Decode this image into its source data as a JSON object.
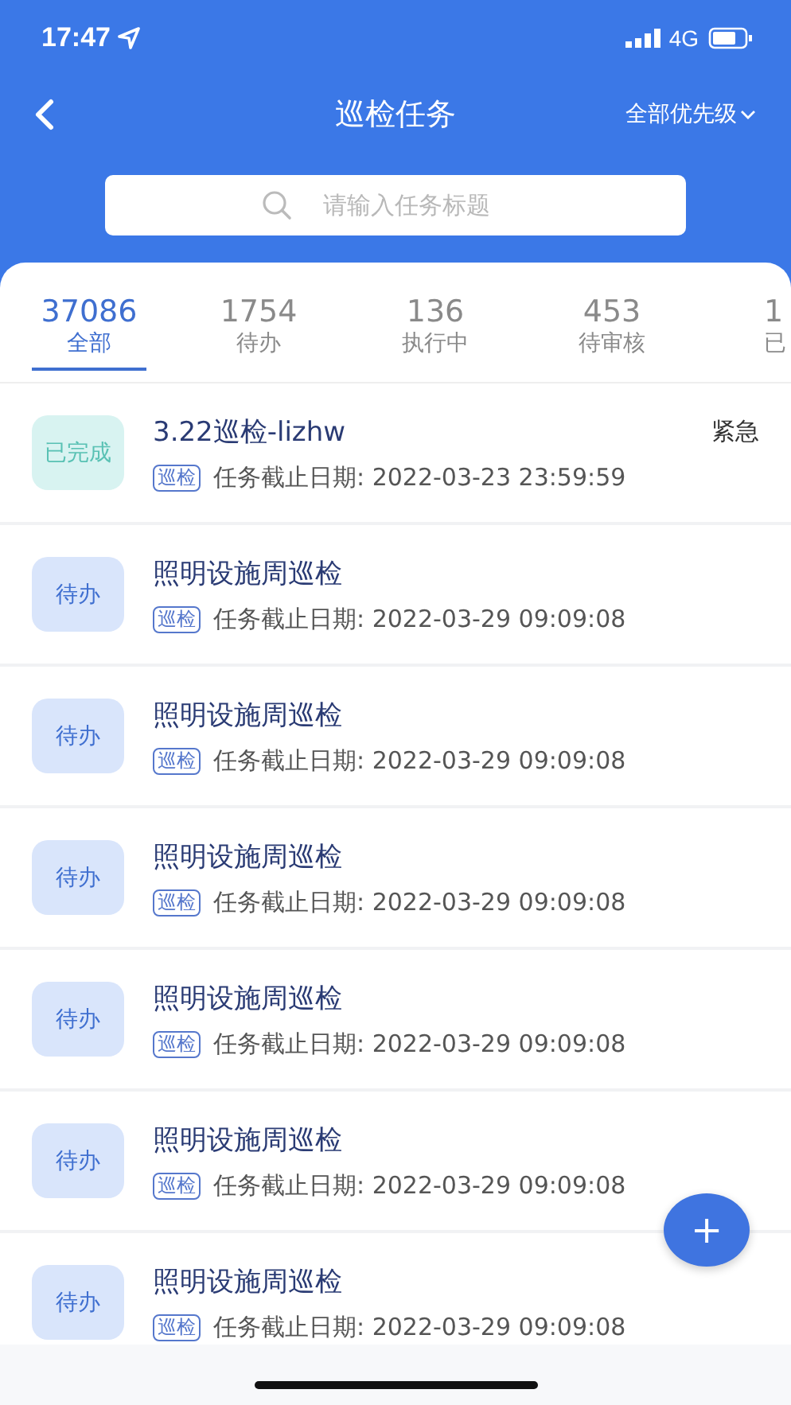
{
  "status_bar": {
    "time": "17:47",
    "network": "4G"
  },
  "nav": {
    "title": "巡检任务",
    "filter": "全部优先级"
  },
  "search": {
    "placeholder": "请输入任务标题"
  },
  "tabs": [
    {
      "count": "37086",
      "label": "全部",
      "selected": true
    },
    {
      "count": "1754",
      "label": "待办",
      "selected": false
    },
    {
      "count": "136",
      "label": "执行中",
      "selected": false
    },
    {
      "count": "453",
      "label": "待审核",
      "selected": false
    },
    {
      "count": "1",
      "label": "已",
      "selected": false
    }
  ],
  "tasks": [
    {
      "status": "已完成",
      "kind": "done",
      "title": "3.22巡检-lizhw",
      "priority": "紧急",
      "tag": "巡检",
      "deadline_label": "任务截止日期:",
      "deadline": "2022-03-23 23:59:59"
    },
    {
      "status": "待办",
      "kind": "todo",
      "title": "照明设施周巡检",
      "tag": "巡检",
      "deadline_label": "任务截止日期:",
      "deadline": "2022-03-29 09:09:08"
    },
    {
      "status": "待办",
      "kind": "todo",
      "title": "照明设施周巡检",
      "tag": "巡检",
      "deadline_label": "任务截止日期:",
      "deadline": "2022-03-29 09:09:08"
    },
    {
      "status": "待办",
      "kind": "todo",
      "title": "照明设施周巡检",
      "tag": "巡检",
      "deadline_label": "任务截止日期:",
      "deadline": "2022-03-29 09:09:08"
    },
    {
      "status": "待办",
      "kind": "todo",
      "title": "照明设施周巡检",
      "tag": "巡检",
      "deadline_label": "任务截止日期:",
      "deadline": "2022-03-29 09:09:08"
    },
    {
      "status": "待办",
      "kind": "todo",
      "title": "照明设施周巡检",
      "tag": "巡检",
      "deadline_label": "任务截止日期:",
      "deadline": "2022-03-29 09:09:08"
    },
    {
      "status": "待办",
      "kind": "todo",
      "title": "照明设施周巡检",
      "tag": "巡检",
      "deadline_label": "任务截止日期:",
      "deadline": "2022-03-29 09:09:08"
    }
  ],
  "fab": {
    "label": "+"
  }
}
